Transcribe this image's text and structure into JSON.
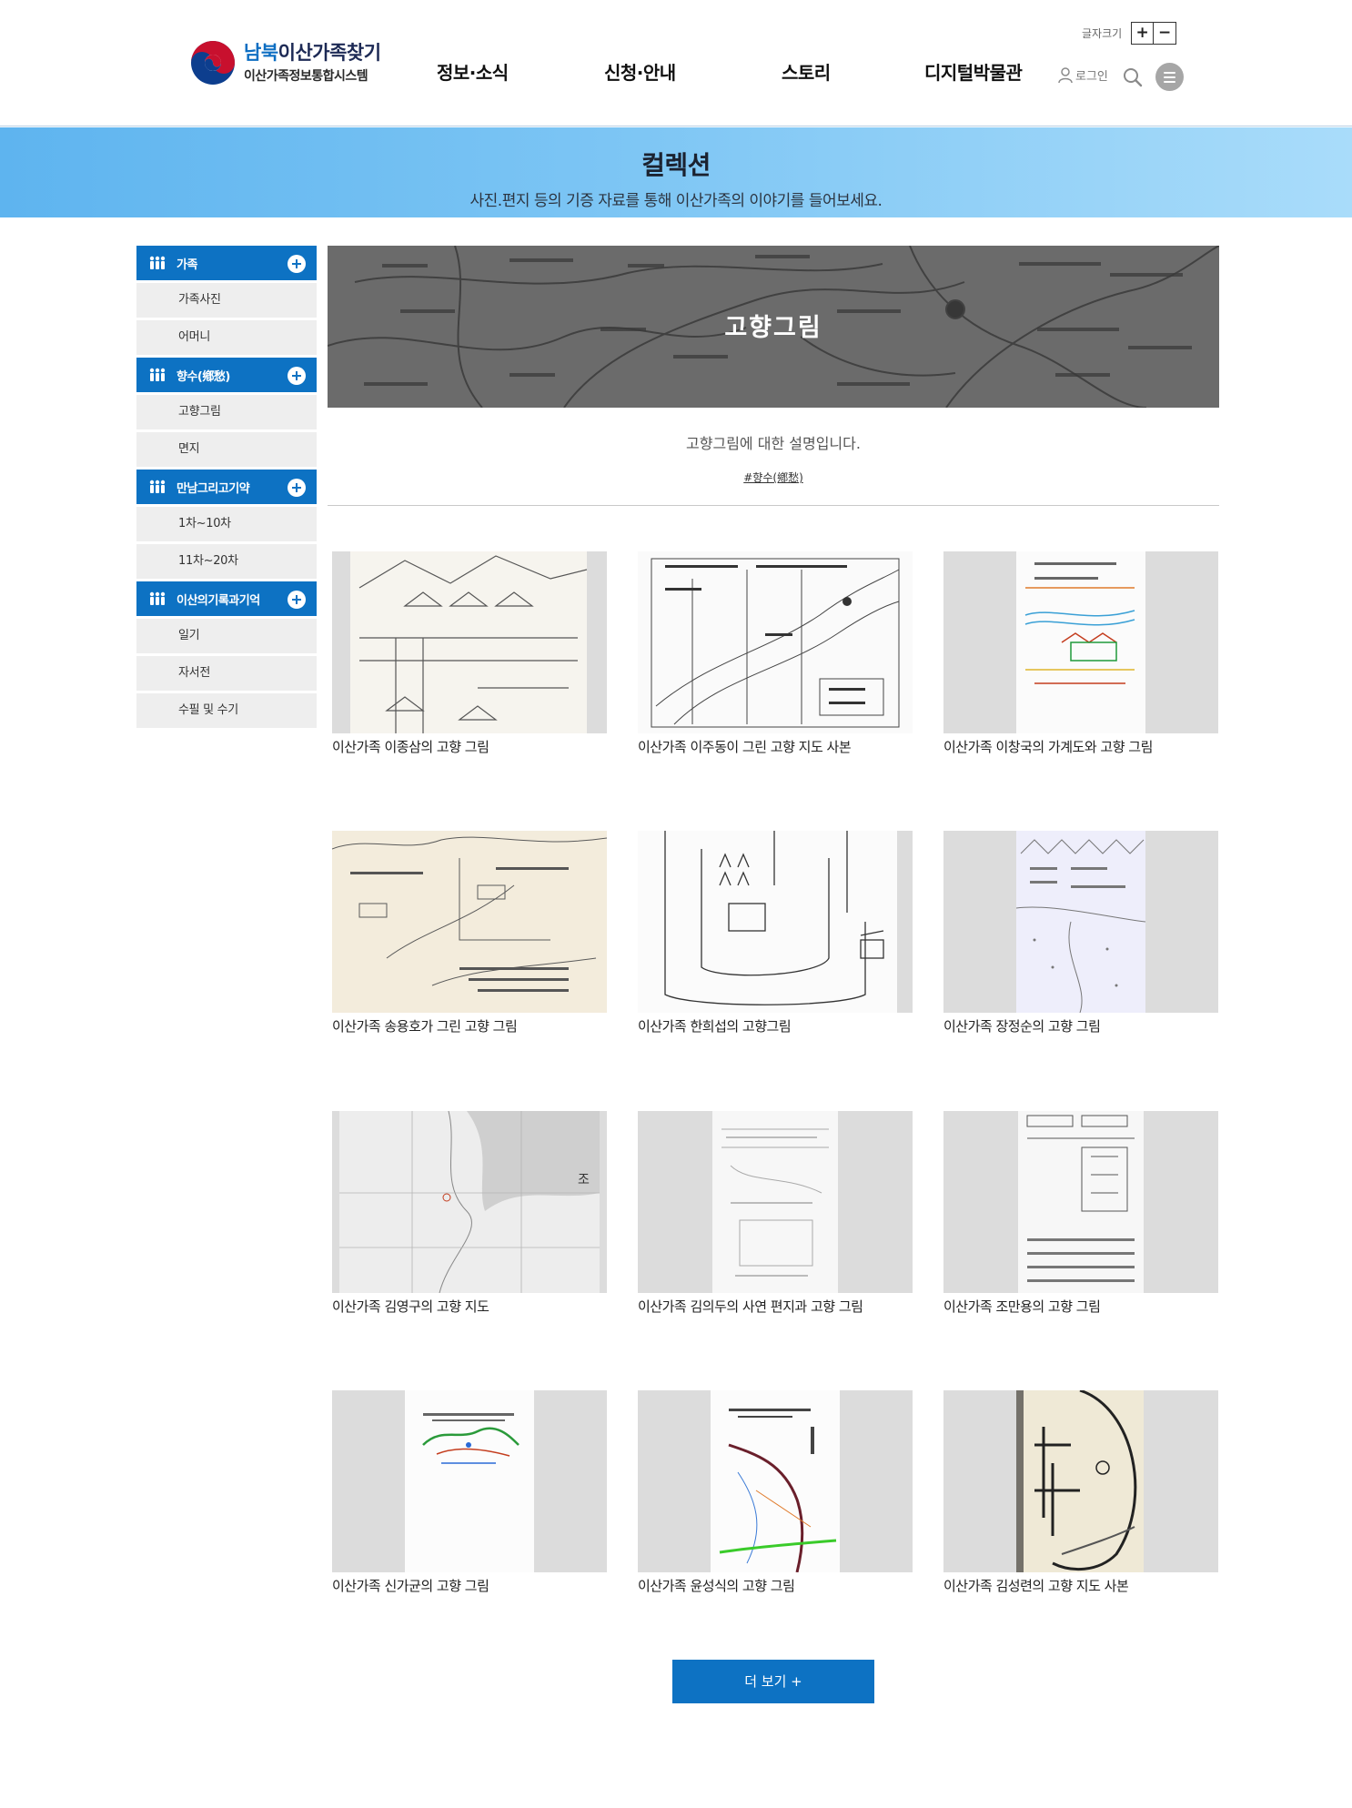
{
  "header": {
    "logo": {
      "title_highlight": "남북",
      "title_rest": "이산가족찾기",
      "subtitle": "이산가족정보통합시스템",
      "colors": {
        "red": "#c8102e",
        "blue": "#0d3e8e",
        "highlight": "#0d6ec2"
      }
    },
    "nav": [
      {
        "label": "정보·소식"
      },
      {
        "label": "신청·안내"
      },
      {
        "label": "스토리"
      },
      {
        "label": "디지털박물관"
      }
    ],
    "font_size": {
      "label": "글자크기",
      "increase": "+",
      "decrease": "−"
    },
    "login_label": "로그인",
    "search_icon": "search-icon",
    "menu_icon": "hamburger-icon"
  },
  "subvisual": {
    "title": "컬렉션",
    "description": "사진.편지 등의 기증 자료를 통해 이산가족의 이야기를 들어보세요."
  },
  "sidebar": {
    "accent": "#0d72c3",
    "groups": [
      {
        "label": "가족",
        "items": [
          "가족사진",
          "어머니"
        ]
      },
      {
        "label": "향수(鄕愁)",
        "items": [
          "고향그림",
          "면지"
        ]
      },
      {
        "label": "만남그리고기약",
        "items": [
          "1차~10차",
          "11차~20차"
        ]
      },
      {
        "label": "이산의기록과기억",
        "items": [
          "일기",
          "자서전",
          "수필 및 수기"
        ]
      }
    ]
  },
  "collection": {
    "banner_title": "고향그림",
    "description": "고향그림에 대한 설명입니다.",
    "tag": "#향수(鄕愁)",
    "items": [
      {
        "title": "이산가족 이종삼의 고향 그림"
      },
      {
        "title": "이산가족 이주동이 그린 고향 지도 사본"
      },
      {
        "title": "이산가족 이창국의 가계도와 고향 그림"
      },
      {
        "title": "이산가족 송용호가 그린 고향 그림"
      },
      {
        "title": "이산가족 한희섭의 고향그림"
      },
      {
        "title": "이산가족 장정순의 고향 그림"
      },
      {
        "title": "이산가족 김영구의 고향 지도"
      },
      {
        "title": "이산가족 김의두의 사연 편지과 고향 그림"
      },
      {
        "title": "이산가족 조만용의 고향 그림"
      },
      {
        "title": "이산가족 신가균의 고향 그림"
      },
      {
        "title": "이산가족 윤성식의 고향 그림"
      },
      {
        "title": "이산가족 김성련의 고향 지도 사본"
      }
    ],
    "more_button": "더 보기 +"
  }
}
